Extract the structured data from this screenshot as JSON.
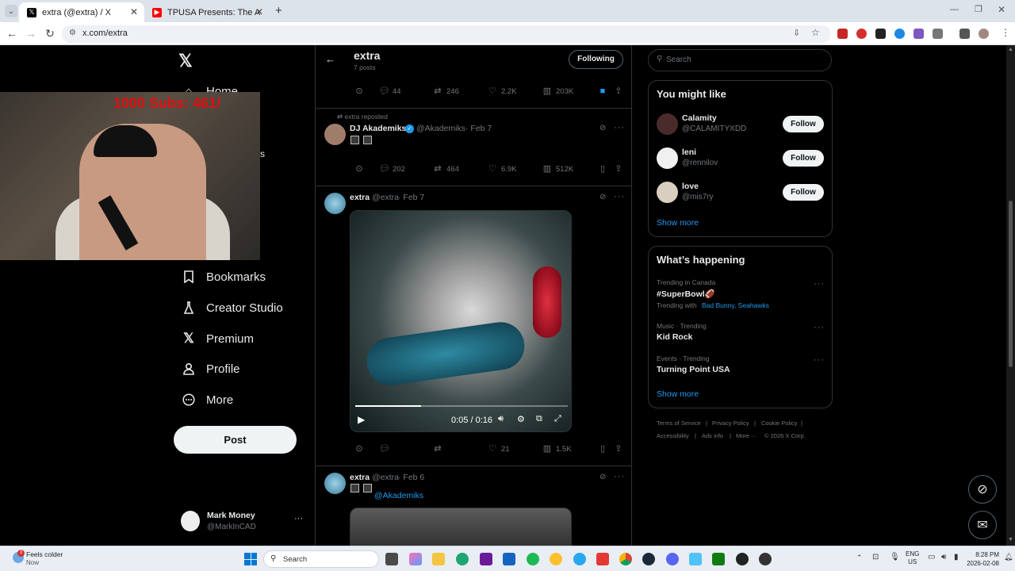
{
  "browser": {
    "tabs": [
      {
        "title": "extra (@extra) / X",
        "active": true
      },
      {
        "title": "TPUSA Presents: The ALL-AMER",
        "active": false
      }
    ],
    "new_tab": "+",
    "url": "x.com/extra"
  },
  "left_nav": {
    "items_visible": [
      {
        "label": "Home",
        "icon": "home-icon"
      },
      {
        "label": "Bookmarks",
        "icon": "bookmark-icon"
      },
      {
        "label": "Creator Studio",
        "icon": "flask-icon"
      },
      {
        "label": "Premium",
        "icon": "x-logo-icon"
      },
      {
        "label": "Profile",
        "icon": "person-icon"
      },
      {
        "label": "More",
        "icon": "more-circle-icon"
      }
    ],
    "partial_s": "s",
    "post_label": "Post",
    "account": {
      "name": "Mark Money",
      "handle": "@MarkInCAD"
    }
  },
  "webcam": {
    "overlay_text": "1000  Subs: 461/"
  },
  "profile_header": {
    "name": "extra",
    "posts": "7 posts",
    "following_label": "Following"
  },
  "posts": [
    {
      "stats": {
        "replies": "44",
        "reposts": "246",
        "likes": "2.2K",
        "views": "203K"
      },
      "bookmarked": true
    },
    {
      "repost_label": "extra reposted",
      "author": "DJ Akademiks",
      "handle": "@Akademiks",
      "date": "· Feb 7",
      "stats": {
        "replies": "202",
        "reposts": "464",
        "likes": "6.9K",
        "views": "512K"
      }
    },
    {
      "author": "extra",
      "handle": "@extra",
      "date": "· Feb 7",
      "video_time": "0:05 / 0:16",
      "video_progress": 0.31,
      "stats": {
        "replies": "",
        "reposts": "",
        "likes": "21",
        "views": "1.5K"
      }
    },
    {
      "author": "extra",
      "handle": "@extra",
      "date": "· Feb 6",
      "mention": "@Akademiks"
    }
  ],
  "right": {
    "search_placeholder": "Search",
    "you_might_like": {
      "title": "You might like",
      "users": [
        {
          "name": "Calamity",
          "handle": "@CALAMITYXDD",
          "button": "Follow"
        },
        {
          "name": "leni",
          "handle": "@rennilov",
          "button": "Follow"
        },
        {
          "name": "love",
          "handle": "@mis7ry",
          "button": "Follow"
        }
      ],
      "show_more": "Show more"
    },
    "whats_happening": {
      "title": "What’s happening",
      "trends": [
        {
          "context": "Trending in Canada",
          "name": "#SuperBowl🏈",
          "with_label": "Trending with",
          "with": "Bad Bunny, Seahawks"
        },
        {
          "context": "Music · Trending",
          "name": "Kid Rock"
        },
        {
          "context": "Events · Trending",
          "name": "Turning Point USA"
        }
      ],
      "show_more": "Show more"
    },
    "footer": {
      "links": [
        "Terms of Service",
        "Privacy Policy",
        "Cookie Policy",
        "Accessibility",
        "Ads info",
        "More ···",
        "© 2026 X Corp."
      ]
    }
  },
  "taskbar": {
    "weather": {
      "title": "Feels colder",
      "sub": "Now",
      "badge": "3"
    },
    "search_placeholder": "Search",
    "lang": "ENG",
    "region": "US",
    "time": "8:28 PM",
    "date": "2026-02-08"
  },
  "colors": {
    "accent": "#1d9bf0",
    "bg": "#000000",
    "border": "#2f3336",
    "muted": "#71767b"
  }
}
